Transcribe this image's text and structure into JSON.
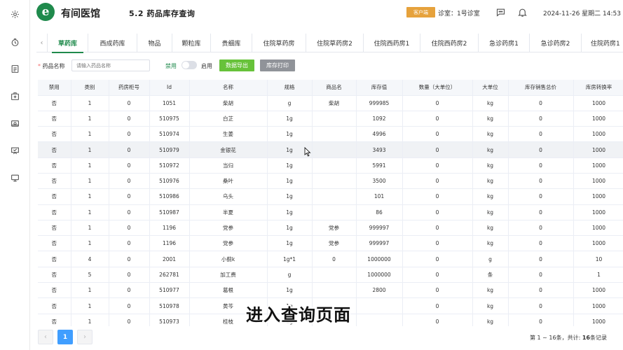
{
  "sidebar": {
    "items": [
      {
        "icon": "gear-icon"
      },
      {
        "icon": "clock-icon"
      },
      {
        "icon": "report-icon"
      },
      {
        "icon": "medkit-icon"
      },
      {
        "icon": "cashier-icon"
      },
      {
        "icon": "presentation-icon"
      },
      {
        "icon": "monitor-icon"
      }
    ]
  },
  "header": {
    "logo_letter": "e",
    "brand": "有间医馆",
    "page_title": "5.2 药品库存查询",
    "client_badge": "客户端",
    "clinic": "诊室：1号诊室",
    "datetime": "2024-11-26 星期二 14:53",
    "brand_color": "#1f8a4c"
  },
  "tabs": {
    "items": [
      {
        "label": "草药库",
        "active": true
      },
      {
        "label": "西成药库",
        "active": false
      },
      {
        "label": "物品",
        "active": false
      },
      {
        "label": "颗粒库",
        "active": false
      },
      {
        "label": "贵细库",
        "active": false
      },
      {
        "label": "住院草药房",
        "active": false
      },
      {
        "label": "住院草药房2",
        "active": false
      },
      {
        "label": "住院西药房1",
        "active": false
      },
      {
        "label": "住院西药房2",
        "active": false
      },
      {
        "label": "急诊药房1",
        "active": false
      },
      {
        "label": "急诊药房2",
        "active": false
      },
      {
        "label": "住院药房1",
        "active": false
      }
    ]
  },
  "filter": {
    "label": "药品名称",
    "required_mark": "*",
    "placeholder": "请输入药品名称",
    "toggle_off_label": "禁用",
    "toggle_on_label": "启用",
    "export_button": "数据导出",
    "print_button": "库存打印"
  },
  "table": {
    "columns": [
      "禁用",
      "类别",
      "药房柜号",
      "Id",
      "名称",
      "规格",
      "商品名",
      "库存值",
      "数量（大单位）",
      "大单位",
      "库存销售总价",
      "库房转换率"
    ],
    "rows": [
      [
        "否",
        "1",
        "0",
        "1051",
        "柴胡",
        "g",
        "柴胡",
        "999985",
        "0",
        "kg",
        "0",
        "1000"
      ],
      [
        "否",
        "1",
        "0",
        "510975",
        "白芷",
        "1g",
        "",
        "1092",
        "0",
        "kg",
        "0",
        "1000"
      ],
      [
        "否",
        "1",
        "0",
        "510974",
        "生姜",
        "1g",
        "",
        "4996",
        "0",
        "kg",
        "0",
        "1000"
      ],
      [
        "否",
        "1",
        "0",
        "510979",
        "金银花",
        "1g",
        "",
        "3493",
        "0",
        "kg",
        "0",
        "1000"
      ],
      [
        "否",
        "1",
        "0",
        "510972",
        "当归",
        "1g",
        "",
        "5991",
        "0",
        "kg",
        "0",
        "1000"
      ],
      [
        "否",
        "1",
        "0",
        "510976",
        "桑叶",
        "1g",
        "",
        "3500",
        "0",
        "kg",
        "0",
        "1000"
      ],
      [
        "否",
        "1",
        "0",
        "510986",
        "乌头",
        "1g",
        "",
        "101",
        "0",
        "kg",
        "0",
        "1000"
      ],
      [
        "否",
        "1",
        "0",
        "510987",
        "半夏",
        "1g",
        "",
        "86",
        "0",
        "kg",
        "0",
        "1000"
      ],
      [
        "否",
        "1",
        "0",
        "1196",
        "党参",
        "1g",
        "党参",
        "999997",
        "0",
        "kg",
        "0",
        "1000"
      ],
      [
        "否",
        "1",
        "0",
        "1196",
        "党参",
        "1g",
        "党参",
        "999997",
        "0",
        "kg",
        "0",
        "1000"
      ],
      [
        "否",
        "4",
        "0",
        "2001",
        "小蓟k",
        "1g*1",
        "0",
        "1000000",
        "0",
        "g",
        "0",
        "10"
      ],
      [
        "否",
        "5",
        "0",
        "262781",
        "加工费",
        "g",
        "",
        "1000000",
        "0",
        "条",
        "0",
        "1"
      ],
      [
        "否",
        "1",
        "0",
        "510977",
        "葛根",
        "1g",
        "",
        "2800",
        "0",
        "kg",
        "0",
        "1000"
      ],
      [
        "否",
        "1",
        "0",
        "510978",
        "黄芩",
        "1g",
        "",
        "",
        "0",
        "kg",
        "0",
        "1000"
      ],
      [
        "否",
        "1",
        "0",
        "510973",
        "桂枝",
        "1g",
        "",
        "",
        "0",
        "kg",
        "0",
        "1000"
      ]
    ]
  },
  "pagination": {
    "current_page": "1",
    "prev_icon": "‹",
    "next_icon": "›",
    "info_prefix": "第 1 ~ 16条，共计: ",
    "info_total": "16",
    "info_suffix": "条记录"
  },
  "overlay": {
    "caption": "进入查询页面"
  }
}
